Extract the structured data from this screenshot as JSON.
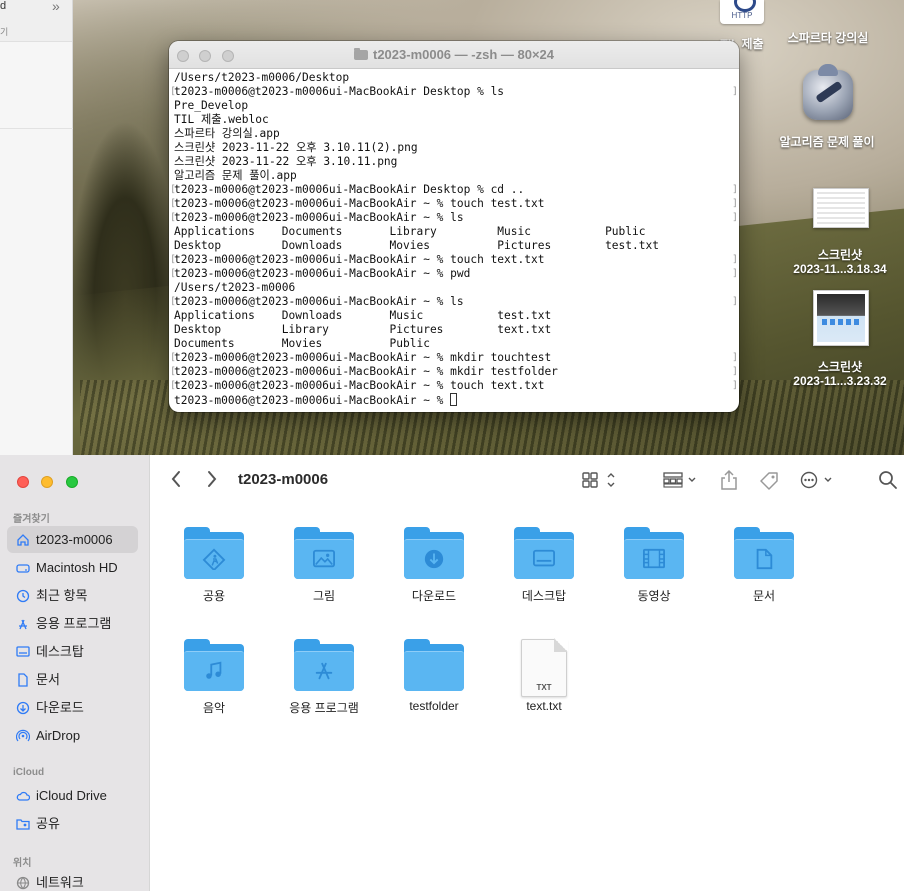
{
  "left_window": {
    "title_fragment": "d",
    "subtitle_fragment": "기"
  },
  "desktop": {
    "icons": [
      {
        "name": "TIL 제출",
        "badge": "HTTP"
      },
      {
        "name": "스파르타 강의실"
      },
      {
        "name": "알고리즘 문제 풀이"
      },
      {
        "name_line1": "스크린샷",
        "name_line2": "2023-11...3.18.34"
      },
      {
        "name_line1": "스크린샷",
        "name_line2": "2023-11...3.23.32"
      }
    ]
  },
  "terminal": {
    "title": "t2023-m0006 — -zsh — 80×24",
    "lines": [
      "/Users/t2023-m0006/Desktop",
      "t2023-m0006@t2023-m0006ui-MacBookAir Desktop % ls",
      "Pre_Develop",
      "TIL 제출.webloc",
      "스파르타 강의실.app",
      "스크린샷 2023-11-22 오후 3.10.11(2).png",
      "스크린샷 2023-11-22 오후 3.10.11.png",
      "알고리즘 문제 풀이.app",
      "t2023-m0006@t2023-m0006ui-MacBookAir Desktop % cd ..",
      "t2023-m0006@t2023-m0006ui-MacBookAir ~ % touch test.txt",
      "t2023-m0006@t2023-m0006ui-MacBookAir ~ % ls",
      "Applications    Documents       Library         Music           Public",
      "Desktop         Downloads       Movies          Pictures        test.txt",
      "t2023-m0006@t2023-m0006ui-MacBookAir ~ % touch text.txt",
      "t2023-m0006@t2023-m0006ui-MacBookAir ~ % pwd",
      "/Users/t2023-m0006",
      "t2023-m0006@t2023-m0006ui-MacBookAir ~ % ls",
      "Applications    Downloads       Music           test.txt",
      "Desktop         Library         Pictures        text.txt",
      "Documents       Movies          Public",
      "t2023-m0006@t2023-m0006ui-MacBookAir ~ % mkdir touchtest",
      "t2023-m0006@t2023-m0006ui-MacBookAir ~ % mkdir testfolder",
      "t2023-m0006@t2023-m0006ui-MacBookAir ~ % touch text.txt",
      "t2023-m0006@t2023-m0006ui-MacBookAir ~ % "
    ],
    "prompt_lines": [
      1,
      8,
      9,
      10,
      13,
      14,
      16,
      20,
      21,
      22
    ]
  },
  "finder": {
    "title": "t2023-m0006",
    "sidebar": {
      "favorites_label": "즐겨찾기",
      "favorites": [
        {
          "label": "t2023-m0006",
          "icon": "home-icon",
          "selected": true
        },
        {
          "label": "Macintosh HD",
          "icon": "disk-icon"
        },
        {
          "label": "최근 항목",
          "icon": "clock-icon"
        },
        {
          "label": "응용 프로그램",
          "icon": "apps-icon"
        },
        {
          "label": "데스크탑",
          "icon": "desktop-icon"
        },
        {
          "label": "문서",
          "icon": "document-icon"
        },
        {
          "label": "다운로드",
          "icon": "download-icon"
        },
        {
          "label": "AirDrop",
          "icon": "airdrop-icon"
        }
      ],
      "icloud_label": "iCloud",
      "icloud": [
        {
          "label": "iCloud Drive",
          "icon": "cloud-icon"
        },
        {
          "label": "공유",
          "icon": "shared-folder-icon"
        }
      ],
      "locations_label": "위치",
      "locations": [
        {
          "label": "네트워크",
          "icon": "network-icon"
        }
      ]
    },
    "items": [
      {
        "label": "공용",
        "type": "folder",
        "glyph": "public"
      },
      {
        "label": "그림",
        "type": "folder",
        "glyph": "pictures"
      },
      {
        "label": "다운로드",
        "type": "folder",
        "glyph": "downloads"
      },
      {
        "label": "데스크탑",
        "type": "folder",
        "glyph": "desktop"
      },
      {
        "label": "동영상",
        "type": "folder",
        "glyph": "movies"
      },
      {
        "label": "문서",
        "type": "folder",
        "glyph": "documents"
      },
      {
        "label": "음악",
        "type": "folder",
        "glyph": "music"
      },
      {
        "label": "응용 프로그램",
        "type": "folder",
        "glyph": "applications"
      },
      {
        "label": "testfolder",
        "type": "folder",
        "glyph": "none"
      },
      {
        "label": "text.txt",
        "type": "file",
        "ext": "TXT"
      }
    ],
    "accent": "#2f7bf6",
    "folder_color": "#5ab6f2"
  }
}
